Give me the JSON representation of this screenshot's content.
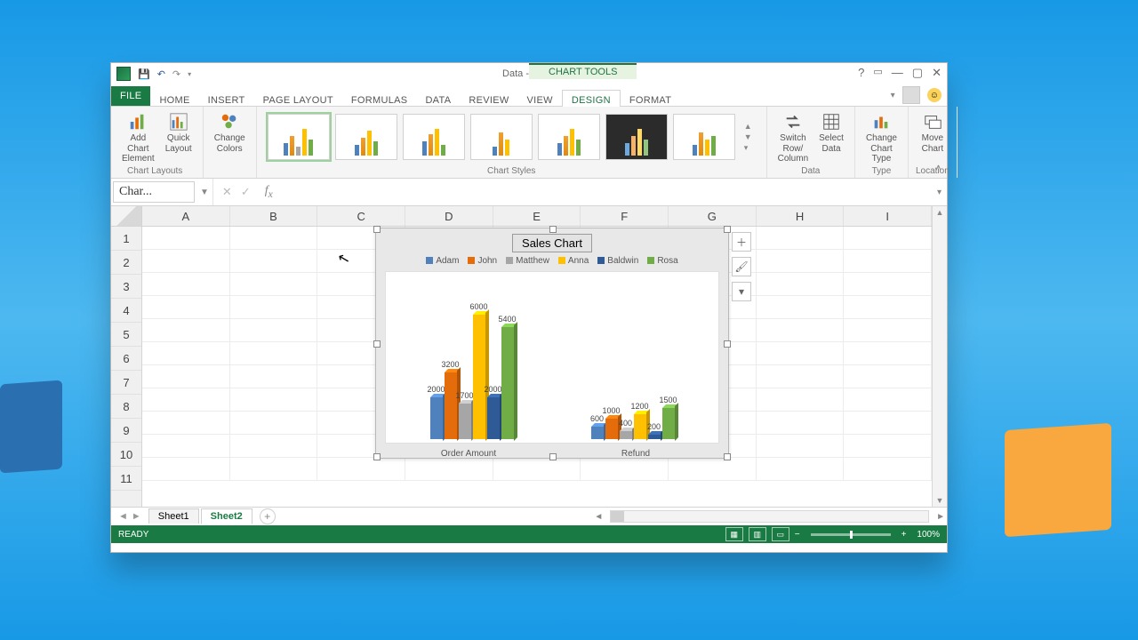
{
  "window": {
    "title": "Data - Excel",
    "chart_tools": "CHART TOOLS"
  },
  "tabs": {
    "file": "FILE",
    "items": [
      "HOME",
      "INSERT",
      "PAGE LAYOUT",
      "FORMULAS",
      "DATA",
      "REVIEW",
      "VIEW",
      "DESIGN",
      "FORMAT"
    ],
    "active": "DESIGN"
  },
  "ribbon": {
    "add_chart_element": "Add Chart\nElement",
    "quick_layout": "Quick\nLayout",
    "change_colors": "Change\nColors",
    "switch_row_col": "Switch Row/\nColumn",
    "select_data": "Select\nData",
    "change_chart_type": "Change\nChart Type",
    "move_chart": "Move\nChart",
    "groups": {
      "chart_layouts": "Chart Layouts",
      "chart_styles": "Chart Styles",
      "data": "Data",
      "type": "Type",
      "location": "Location"
    }
  },
  "namebox": "Char...",
  "columns": [
    "A",
    "B",
    "C",
    "D",
    "E",
    "F",
    "G",
    "H",
    "I"
  ],
  "rows": [
    1,
    2,
    3,
    4,
    5,
    6,
    7,
    8,
    9,
    10,
    11
  ],
  "chart": {
    "title": "Sales Chart",
    "legend": [
      "Adam",
      "John",
      "Matthew",
      "Anna",
      "Baldwin",
      "Rosa"
    ],
    "categories": [
      "Order Amount",
      "Refund"
    ]
  },
  "chart_data": {
    "type": "bar",
    "title": "Sales Chart",
    "categories": [
      "Order Amount",
      "Refund"
    ],
    "series": [
      {
        "name": "Adam",
        "color": "#4f81bd",
        "values": [
          2000,
          600
        ]
      },
      {
        "name": "John",
        "color": "#e46c0a",
        "values": [
          3200,
          1000
        ]
      },
      {
        "name": "Matthew",
        "color": "#a6a6a6",
        "values": [
          1700,
          400
        ]
      },
      {
        "name": "Anna",
        "color": "#ffc000",
        "values": [
          6000,
          1200
        ]
      },
      {
        "name": "Baldwin",
        "color": "#2e5b96",
        "values": [
          2000,
          200
        ]
      },
      {
        "name": "Rosa",
        "color": "#70ad47",
        "values": [
          5400,
          1500
        ]
      }
    ],
    "ylim": [
      0,
      6000
    ]
  },
  "sheets": {
    "items": [
      "Sheet1",
      "Sheet2"
    ],
    "active": "Sheet2"
  },
  "status": {
    "ready": "READY",
    "zoom": "100%"
  }
}
